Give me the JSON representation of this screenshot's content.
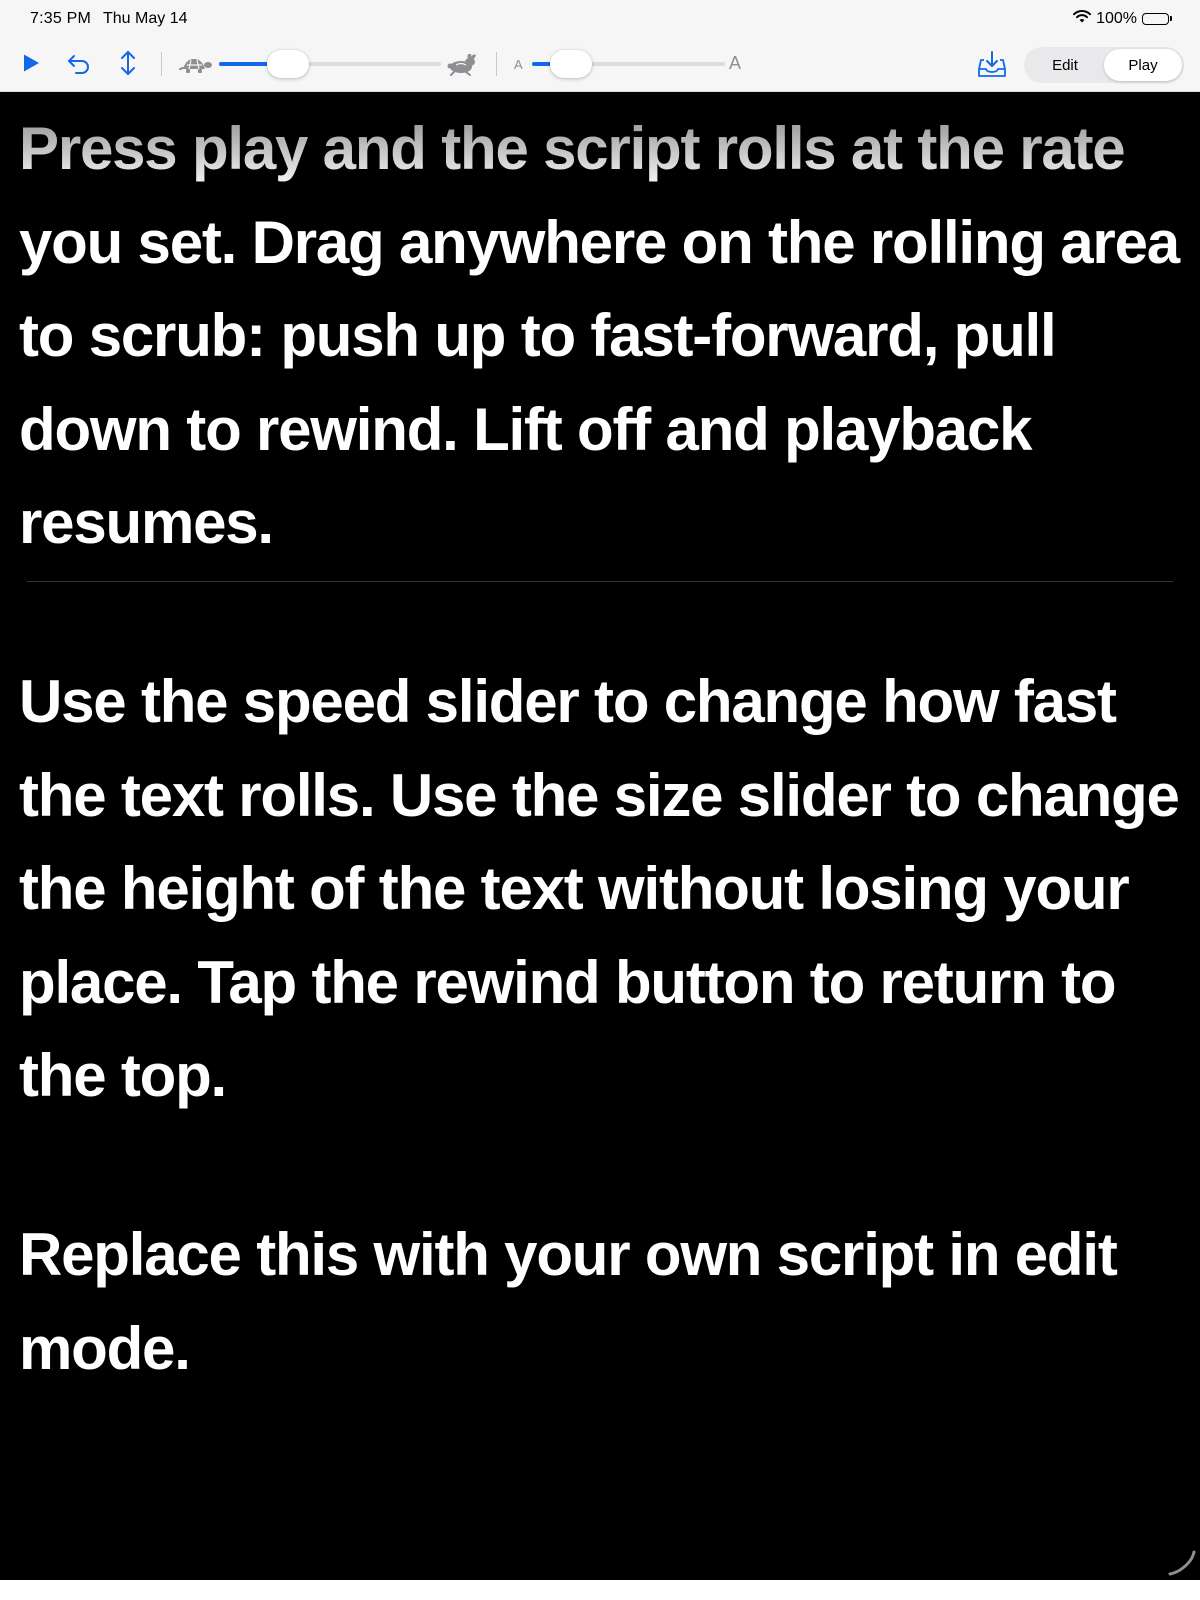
{
  "status_bar": {
    "time": "7:35 PM",
    "date": "Thu May 14",
    "battery_percent": "100%",
    "battery_level": 1.0
  },
  "toolbar": {
    "play_icon": "play-icon",
    "rewind_icon": "rewind-icon",
    "scrub_icon": "vertical-arrows-icon",
    "speed_slider": {
      "min_icon": "turtle-icon",
      "max_icon": "hare-icon",
      "value": 0.31
    },
    "size_slider": {
      "min_label": "A",
      "max_label": "A",
      "value": 0.2
    },
    "export_icon": "tray-download-icon",
    "mode_segments": [
      {
        "label": "Edit",
        "selected": false
      },
      {
        "label": "Play",
        "selected": true
      }
    ]
  },
  "prompter": {
    "paragraphs": [
      "Press play and the script rolls at the rate you set. Drag anywhere on the rolling area to scrub: push up to fast-forward, pull down to rewind. Lift off and playback resumes.",
      "Use the speed slider to change how fast the text rolls. Use the size slider to change the height of the text without losing your place. Tap the rewind button to return to the top.",
      "Replace this with your own script in edit mode."
    ]
  },
  "colors": {
    "accent": "#1368ea",
    "background": "#000000",
    "text": "#ffffff",
    "toolbar": "#f6f6f7"
  }
}
